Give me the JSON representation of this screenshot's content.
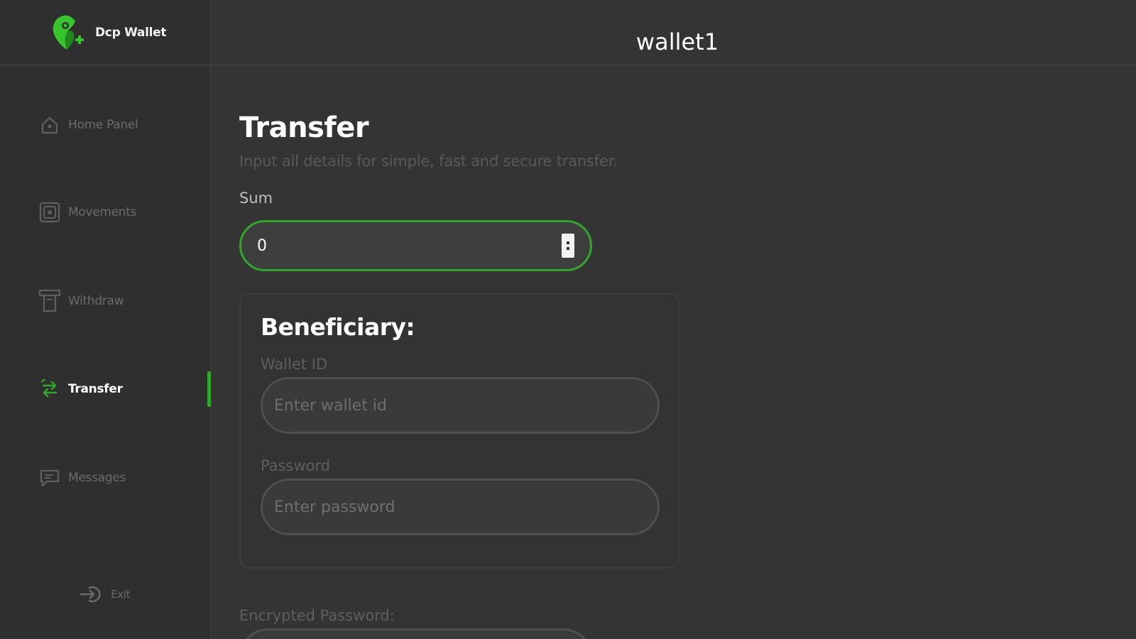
{
  "brand": {
    "name": "Dcp Wallet",
    "accent": "#2fa82a"
  },
  "header": {
    "title": "wallet1"
  },
  "sidebar": {
    "items": [
      {
        "label": "Home Panel",
        "icon": "home-icon",
        "active": false
      },
      {
        "label": "Movements",
        "icon": "movements-icon",
        "active": false
      },
      {
        "label": "Withdraw",
        "icon": "withdraw-icon",
        "active": false
      },
      {
        "label": "Transfer",
        "icon": "transfer-icon",
        "active": true
      },
      {
        "label": "Messages",
        "icon": "messages-icon",
        "active": false
      }
    ],
    "exit_label": "Exit"
  },
  "main": {
    "title": "Transfer",
    "subtitle": "Input all details for simple, fast and secure transfer.",
    "sum": {
      "label": "Sum",
      "value": "0"
    },
    "beneficiary": {
      "title": "Beneficiary:",
      "wallet_id": {
        "label": "Wallet ID",
        "placeholder": "Enter wallet id",
        "value": ""
      },
      "password": {
        "label": "Password",
        "placeholder": "Enter password",
        "value": ""
      }
    },
    "encrypted_password": {
      "label": "Encrypted Password:"
    }
  }
}
